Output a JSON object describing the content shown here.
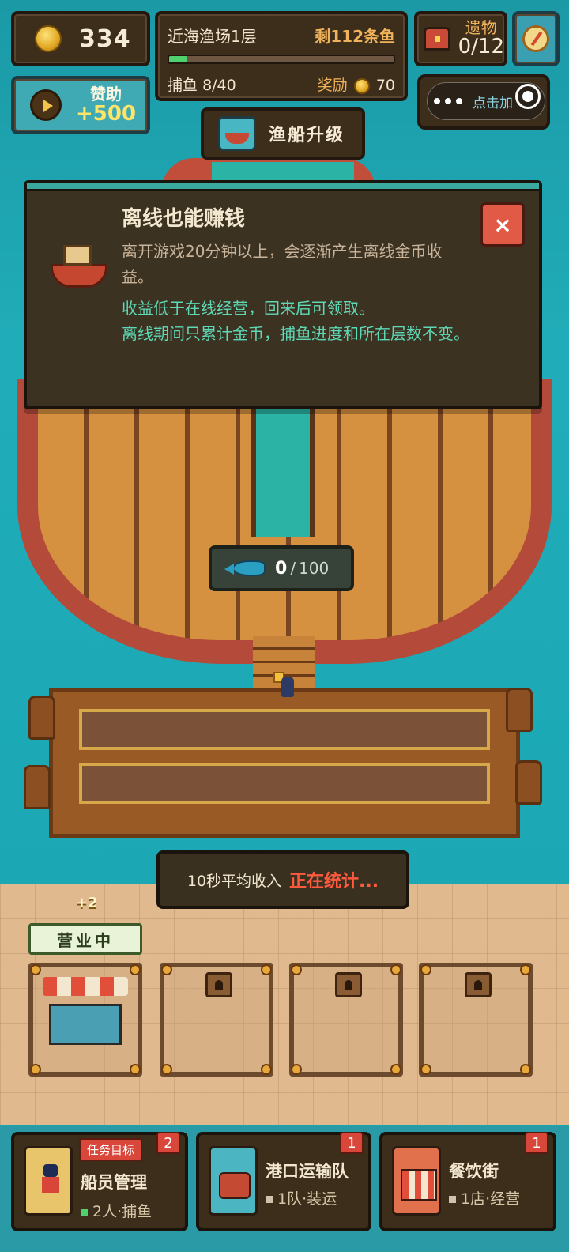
{
  "hud": {
    "coins": "334",
    "level": {
      "name": "近海渔场1层",
      "remaining": "剩112条鱼",
      "progress": 0.08,
      "catch_label": "捕鱼",
      "catch_value": "8/40",
      "reward_label": "奖励",
      "reward_value": "70"
    },
    "relic": {
      "label": "遗物",
      "value": "0/12"
    },
    "sponsor": {
      "label": "赞助",
      "value": "+500"
    },
    "capsule_hint": "点击加"
  },
  "upgrade_button": {
    "label": "渔船升级"
  },
  "dialog": {
    "title": "离线也能赚钱",
    "description": "离开游戏20分钟以上，会逐渐产生离线金币收益。",
    "note_line1": "收益低于在线经营，回来后可领取。",
    "note_line2": "离线期间只累计金币，捕鱼进度和所在层数不变。",
    "close_label": "×"
  },
  "fish_counter": {
    "current": "0",
    "separator": "/",
    "max": "100"
  },
  "income": {
    "label": "10秒平均收入",
    "status": "正在统计..."
  },
  "plus_tag": "+2",
  "shop": {
    "badge": "营业中"
  },
  "nav": [
    {
      "task_tag": "任务目标",
      "title": "船员管理",
      "sub": "2人·捕鱼",
      "badge": "2",
      "dot_color": "#4fd16e"
    },
    {
      "title": "港口运输队",
      "sub": "1队·装运",
      "badge": "1",
      "dot_color": "#cfc3ad"
    },
    {
      "title": "餐饮街",
      "sub": "1店·经营",
      "badge": "1",
      "dot_color": "#cfc3ad"
    }
  ],
  "colors": {
    "sea": "#1aa3b0",
    "panel": "#3d2e1c",
    "accent_orange": "#f0b25a",
    "highlight_green": "#5fd8b6",
    "alert_red": "#ff5a3e"
  }
}
